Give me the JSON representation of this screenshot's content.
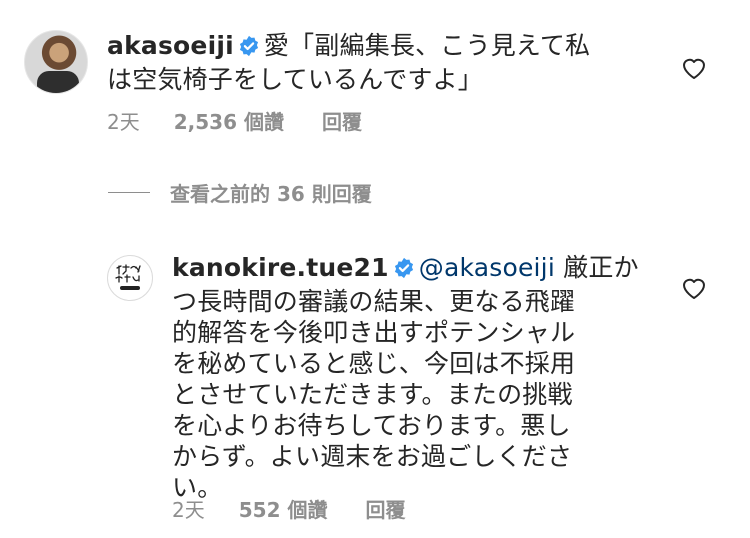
{
  "comments": [
    {
      "username": "akasoeiji",
      "text_line1": "愛「副編集長、こう見えて私",
      "text_line2": "は空気椅子をしているんですよ」",
      "time": "2天",
      "likes": "2,536 個讚",
      "reply": "回覆"
    },
    {
      "username": "kanokire.tue21",
      "mention": "@akasoeiji",
      "text_line1": "厳正か",
      "lines": [
        "つ長時間の審議の結果、更なる飛躍",
        "的解答を今後叩き出すポテンシャル",
        "を秘めていると感じ、今回は不採用",
        "とさせていただきます。またの挑戦",
        "を心よりお待ちしております。悪し",
        "からず。よい週末をお過ごしくださ",
        "い。"
      ],
      "time": "2天",
      "likes": "552 個讚",
      "reply": "回覆"
    }
  ],
  "view_replies_label": "查看之前的 36 則回覆",
  "icons": {
    "verified": "verified-badge-icon",
    "like": "heart-icon"
  },
  "colors": {
    "verified": "#3897f0",
    "meta": "#8e8e8e",
    "mention": "#00376b"
  }
}
